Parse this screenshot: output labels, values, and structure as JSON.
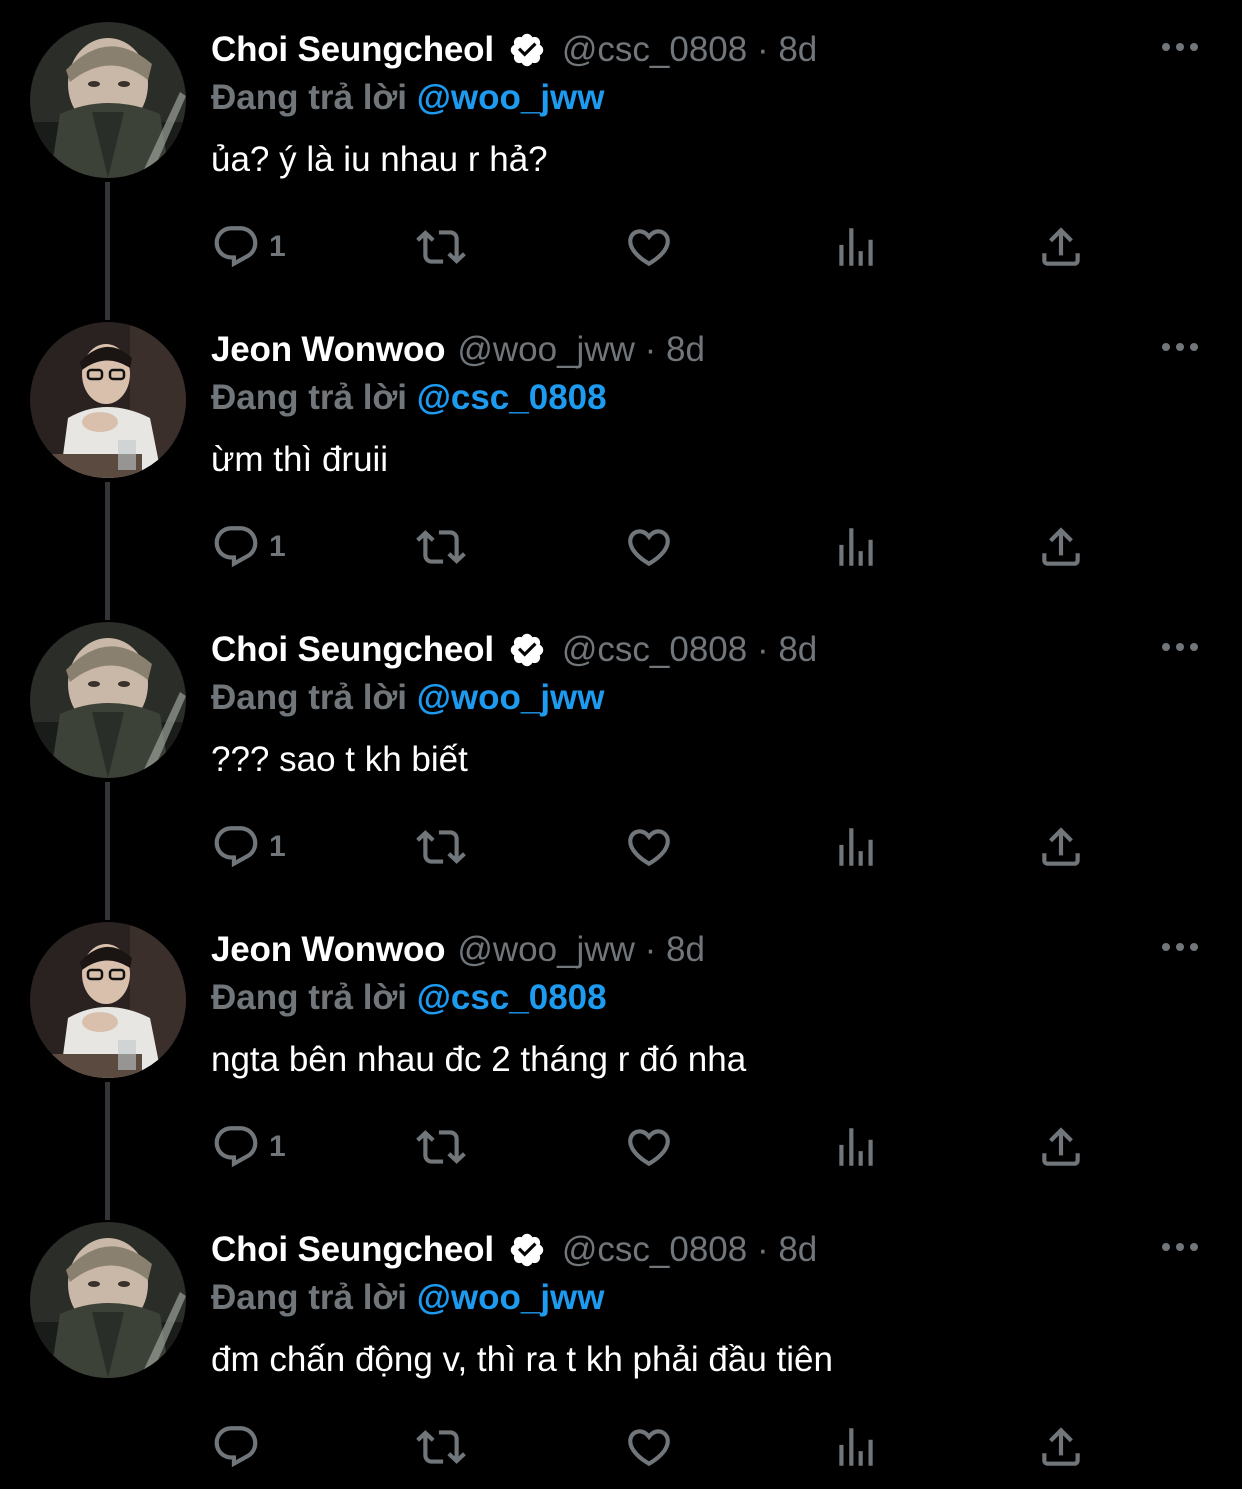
{
  "colors": {
    "background": "#000000",
    "name": "#ffffff",
    "secondary": "#71767b",
    "mention": "#1d9bf0",
    "thread_line": "#333639"
  },
  "icons": {
    "verified": "verified-badge-icon",
    "more": "more-options-icon",
    "reply": "reply-icon",
    "retweet": "retweet-icon",
    "like": "heart-icon",
    "views": "views-chart-icon",
    "share": "share-icon"
  },
  "tweets": [
    {
      "display_name": "Choi Seungcheol",
      "verified": true,
      "handle_time": "@csc_0808 · 8d",
      "reply_prefix": "Đang trả lời ",
      "reply_mention": "@woo_jww",
      "text": "ủa? ý là iu nhau r hả?",
      "reply_count": "1"
    },
    {
      "display_name": "Jeon Wonwoo",
      "verified": false,
      "handle_time": "@woo_jww · 8d",
      "reply_prefix": "Đang trả lời ",
      "reply_mention": "@csc_0808",
      "text": "ừm thì đruii",
      "reply_count": "1"
    },
    {
      "display_name": "Choi Seungcheol",
      "verified": true,
      "handle_time": "@csc_0808 · 8d",
      "reply_prefix": "Đang trả lời ",
      "reply_mention": "@woo_jww",
      "text": "??? sao t kh biết",
      "reply_count": "1"
    },
    {
      "display_name": "Jeon Wonwoo",
      "verified": false,
      "handle_time": "@woo_jww · 8d",
      "reply_prefix": "Đang trả lời ",
      "reply_mention": "@csc_0808",
      "text": "ngta bên nhau đc 2 tháng r đó nha",
      "reply_count": "1"
    },
    {
      "display_name": "Choi Seungcheol",
      "verified": true,
      "handle_time": "@csc_0808 · 8d",
      "reply_prefix": "Đang trả lời ",
      "reply_mention": "@woo_jww",
      "text": "đm chấn động v, thì ra t kh phải đầu tiên",
      "reply_count": ""
    }
  ]
}
